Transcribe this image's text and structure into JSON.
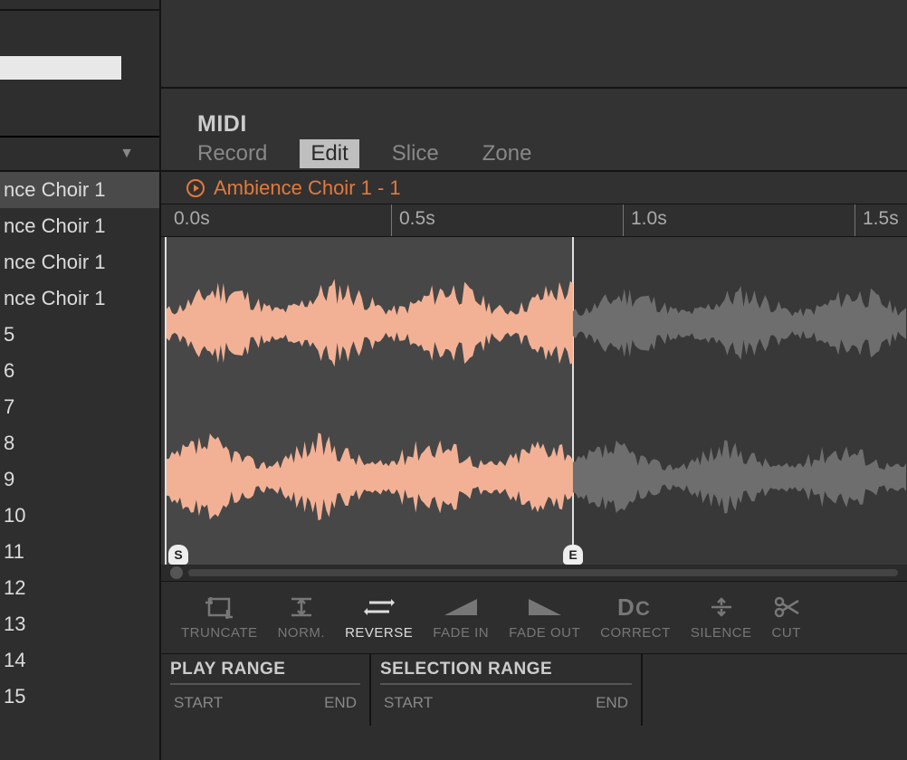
{
  "sidebar": {
    "items": [
      "nce Choir 1",
      "nce Choir 1",
      "nce Choir 1",
      "nce Choir 1",
      "5",
      "6",
      "7",
      "8",
      "9",
      "10",
      "11",
      "12",
      "13",
      "14",
      "15"
    ]
  },
  "header": {
    "tab_midi": "MIDI"
  },
  "edit_tabs": {
    "record": "Record",
    "edit": "Edit",
    "slice": "Slice",
    "zone": "Zone"
  },
  "sample": {
    "name": "Ambience Choir 1 - 1"
  },
  "ruler": {
    "t0": "0.0s",
    "t1": "0.5s",
    "t2": "1.0s",
    "t3": "1.5s"
  },
  "markers": {
    "start": "S",
    "end": "E"
  },
  "tools": {
    "truncate": "TRUNCATE",
    "norm": "NORM.",
    "reverse": "REVERSE",
    "fadein": "FADE IN",
    "fadeout": "FADE OUT",
    "correct": "CORRECT",
    "silence": "SILENCE",
    "cut": "CUT"
  },
  "ranges": {
    "play_title": "PLAY RANGE",
    "sel_title": "SELECTION RANGE",
    "start": "START",
    "end": "END"
  },
  "colors": {
    "accent": "#e27a3d",
    "wave_active": "#f2b195",
    "wave_inactive": "#6e6e6e"
  }
}
